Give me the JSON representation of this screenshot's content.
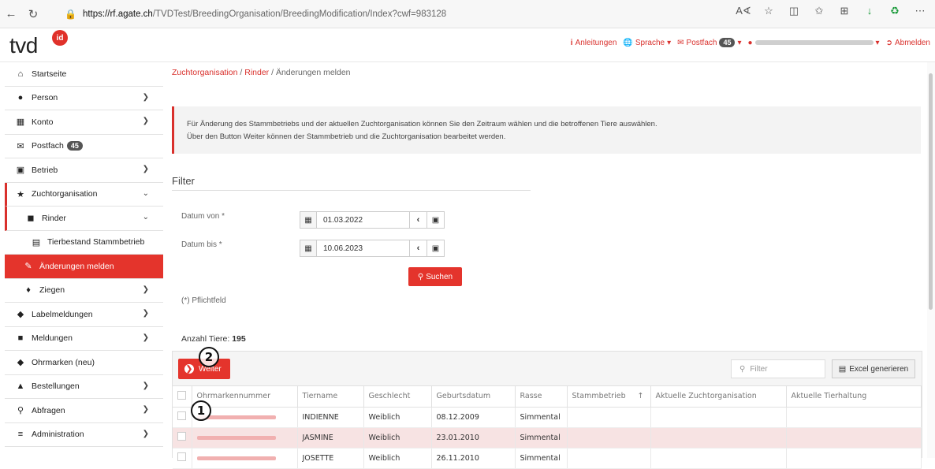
{
  "browser": {
    "url_host": "https://rf.agate.ch",
    "url_path": "/TVDTest/BreedingOrganisation/BreedingModification/Index?cwf=983128"
  },
  "header": {
    "logo_text": "tvd",
    "logo_badge": "id",
    "anleitungen": "Anleitungen",
    "sprache": "Sprache",
    "postfach": "Postfach",
    "postfach_count": "45",
    "abmelden": "Abmelden"
  },
  "sidebar": {
    "items": [
      {
        "label": "Startseite",
        "icon": "home-icon"
      },
      {
        "label": "Person",
        "icon": "person-icon"
      },
      {
        "label": "Konto",
        "icon": "card-icon"
      },
      {
        "label": "Postfach",
        "icon": "mail-icon",
        "badge": "45"
      },
      {
        "label": "Betrieb",
        "icon": "factory-icon"
      },
      {
        "label": "Zuchtorganisation",
        "icon": "star-icon"
      },
      {
        "label": "Rinder",
        "icon": "cow-icon"
      },
      {
        "label": "Tierbestand Stammbetrieb",
        "icon": "list-icon"
      },
      {
        "label": "Änderungen melden",
        "icon": "pencil-icon"
      },
      {
        "label": "Ziegen",
        "icon": "goat-icon"
      },
      {
        "label": "Labelmeldungen",
        "icon": "tag-icon"
      },
      {
        "label": "Meldungen",
        "icon": "clipboard-icon"
      },
      {
        "label": "Ohrmarken (neu)",
        "icon": "tag-icon"
      },
      {
        "label": "Bestellungen",
        "icon": "bag-icon"
      },
      {
        "label": "Abfragen",
        "icon": "search-icon"
      },
      {
        "label": "Administration",
        "icon": "sliders-icon"
      }
    ]
  },
  "breadcrumb": {
    "level1": "Zuchtorganisation",
    "level2": "Rinder",
    "current": "Änderungen melden"
  },
  "info": {
    "line1": "Für Änderung des Stammbetriebs und der aktuellen Zuchtorganisation können Sie den Zeitraum wählen und die betroffenen Tiere auswählen.",
    "line2": "Über den Button Weiter können der Stammbetrieb und die Zuchtorganisation bearbeitet werden."
  },
  "filter": {
    "title": "Filter",
    "date_from_label": "Datum von *",
    "date_from_value": "01.03.2022",
    "date_to_label": "Datum bis *",
    "date_to_value": "10.06.2023",
    "search_label": "Suchen",
    "required_note": "(*) Pflichtfeld"
  },
  "summary": {
    "count_label": "Anzahl Tiere:",
    "count_value": "195"
  },
  "toolbar": {
    "weiter_label": "Weiter",
    "filter_placeholder": "Filter",
    "excel_label": "Excel generieren"
  },
  "table": {
    "headers": [
      "Ohrmarkennummer",
      "Tiername",
      "Geschlecht",
      "Geburtsdatum",
      "Rasse",
      "Stammbetrieb",
      "Aktuelle Zuchtorganisation",
      "Aktuelle Tierhaltung"
    ],
    "rows": [
      {
        "tiername": "INDIENNE",
        "geschlecht": "Weiblich",
        "geburtsdatum": "08.12.2009",
        "rasse": "Simmental",
        "selected": false
      },
      {
        "tiername": "JASMINE",
        "geschlecht": "Weiblich",
        "geburtsdatum": "23.01.2010",
        "rasse": "Simmental",
        "selected": true
      },
      {
        "tiername": "JOSETTE",
        "geschlecht": "Weiblich",
        "geburtsdatum": "26.11.2010",
        "rasse": "Simmental",
        "selected": false
      }
    ]
  },
  "markers": {
    "one": "1",
    "two": "2"
  },
  "colors": {
    "accent": "#e4342c",
    "selected_row": "#f7e3e3"
  }
}
